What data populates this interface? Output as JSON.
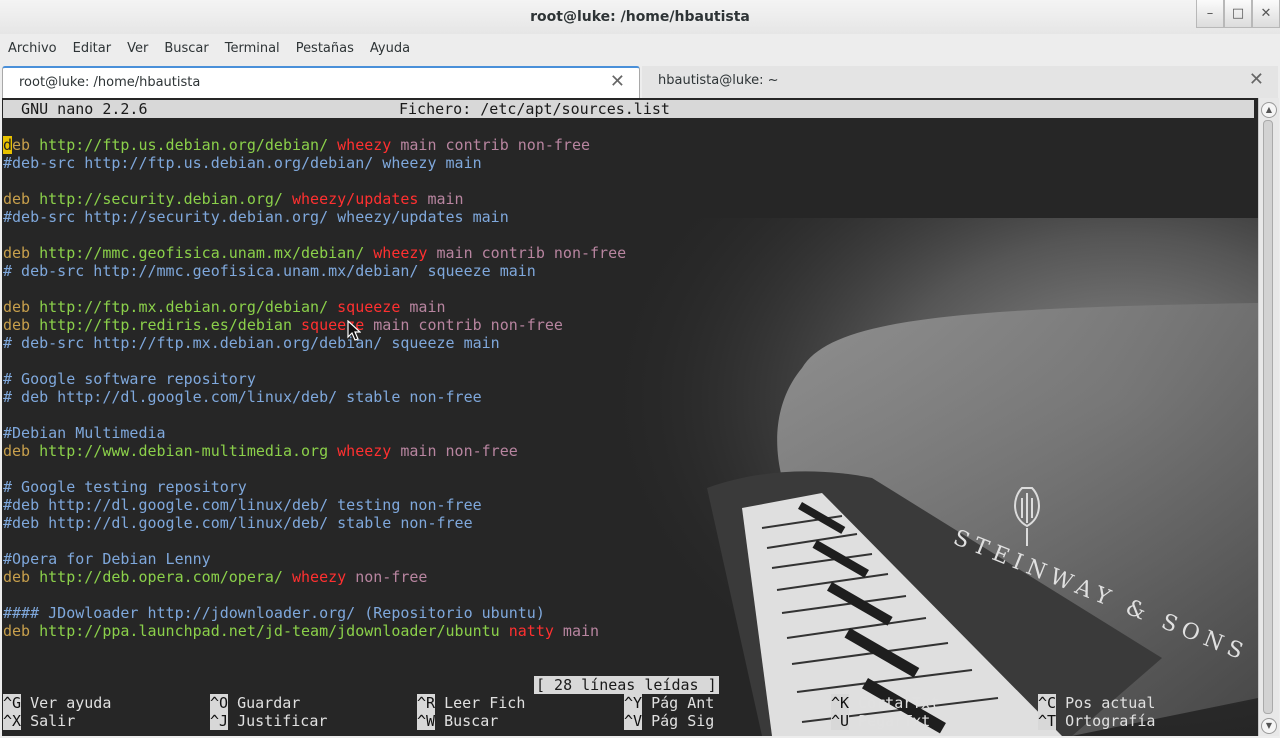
{
  "window": {
    "title": "root@luke: /home/hbautista",
    "buttons": {
      "minimize": "–",
      "maximize": "□",
      "close": "✕"
    }
  },
  "menu": [
    "Archivo",
    "Editar",
    "Ver",
    "Buscar",
    "Terminal",
    "Pestañas",
    "Ayuda"
  ],
  "tabs": [
    {
      "label": "root@luke: /home/hbautista",
      "close": "✕"
    },
    {
      "label": "hbautista@luke: ~",
      "close": "✕"
    }
  ],
  "nano": {
    "version": "  GNU nano 2.2.6",
    "file": "Fichero: /etc/apt/sources.list",
    "status": "[ 28 líneas leídas ]",
    "lines": [
      [
        [
          "c",
          "d"
        ],
        [
          "kw",
          "eb "
        ],
        [
          "url",
          "http://ftp.us.debian.org/debian/ "
        ],
        [
          "rel",
          "wheezy "
        ],
        [
          "comp",
          "main contrib non-free"
        ]
      ],
      [
        [
          "cmt",
          "#deb-src http://ftp.us.debian.org/debian/ wheezy main"
        ]
      ],
      [],
      [
        [
          "kw",
          "deb "
        ],
        [
          "url",
          "http://security.debian.org/ "
        ],
        [
          "rel",
          "wheezy/updates "
        ],
        [
          "comp",
          "main"
        ]
      ],
      [
        [
          "cmt",
          "#deb-src http://security.debian.org/ wheezy/updates main"
        ]
      ],
      [],
      [
        [
          "kw",
          "deb "
        ],
        [
          "url",
          "http://mmc.geofisica.unam.mx/debian/ "
        ],
        [
          "rel",
          "wheezy "
        ],
        [
          "comp",
          "main contrib non-free"
        ]
      ],
      [
        [
          "cmt",
          "# deb-src http://mmc.geofisica.unam.mx/debian/ squeeze main"
        ]
      ],
      [],
      [
        [
          "kw",
          "deb "
        ],
        [
          "url",
          "http://ftp.mx.debian.org/debian/ "
        ],
        [
          "rel",
          "squeeze "
        ],
        [
          "comp",
          "main"
        ]
      ],
      [
        [
          "kw",
          "deb "
        ],
        [
          "url",
          "http://ftp.rediris.es/debian "
        ],
        [
          "rel",
          "squeeze "
        ],
        [
          "comp",
          "main contrib non-free"
        ]
      ],
      [
        [
          "cmt",
          "# deb-src http://ftp.mx.debian.org/debian/ squeeze main"
        ]
      ],
      [],
      [
        [
          "cmt",
          "# Google software repository"
        ]
      ],
      [
        [
          "cmt",
          "# deb http://dl.google.com/linux/deb/ stable non-free"
        ]
      ],
      [],
      [
        [
          "cmt",
          "#Debian Multimedia"
        ]
      ],
      [
        [
          "kw",
          "deb "
        ],
        [
          "url",
          "http://www.debian-multimedia.org "
        ],
        [
          "rel",
          "wheezy "
        ],
        [
          "comp",
          "main non-free"
        ]
      ],
      [],
      [
        [
          "cmt",
          "# Google testing repository"
        ]
      ],
      [
        [
          "cmt",
          "#deb http://dl.google.com/linux/deb/ testing non-free"
        ]
      ],
      [
        [
          "cmt",
          "#deb http://dl.google.com/linux/deb/ stable non-free"
        ]
      ],
      [],
      [
        [
          "cmt",
          "#Opera for Debian Lenny"
        ]
      ],
      [
        [
          "kw",
          "deb "
        ],
        [
          "url",
          "http://deb.opera.com/opera/ "
        ],
        [
          "rel",
          "wheezy "
        ],
        [
          "comp",
          "non-free"
        ]
      ],
      [],
      [
        [
          "cmt",
          "#### JDowloader http://jdownloader.org/ (Repositorio ubuntu)"
        ]
      ],
      [
        [
          "kw",
          "deb "
        ],
        [
          "url",
          "http://ppa.launchpad.net/jd-team/jdownloader/ubuntu "
        ],
        [
          "rel",
          "natty "
        ],
        [
          "comp",
          "main"
        ]
      ]
    ],
    "shortcuts": [
      [
        [
          "^G",
          "Ver ayuda"
        ],
        [
          "^O",
          "Guardar"
        ],
        [
          "^R",
          "Leer Fich"
        ],
        [
          "^Y",
          "Pág Ant"
        ],
        [
          "^K",
          "CortarTxt"
        ],
        [
          "^C",
          "Pos actual"
        ]
      ],
      [
        [
          "^X",
          "Salir"
        ],
        [
          "^J",
          "Justificar"
        ],
        [
          "^W",
          "Buscar"
        ],
        [
          "^V",
          "Pág Sig"
        ],
        [
          "^U",
          "PegarTxt"
        ],
        [
          "^T",
          "Ortografía"
        ]
      ]
    ]
  },
  "colors": {
    "terminal_bg": "#262626",
    "keyword": "#c8a04c",
    "url": "#8bd04a",
    "release": "#ff3030",
    "component": "#b885a0",
    "comment": "#7fa8dc",
    "tab_accent": "#4a90d9"
  },
  "icons": {
    "mouse": "mouse-pointer-icon"
  }
}
